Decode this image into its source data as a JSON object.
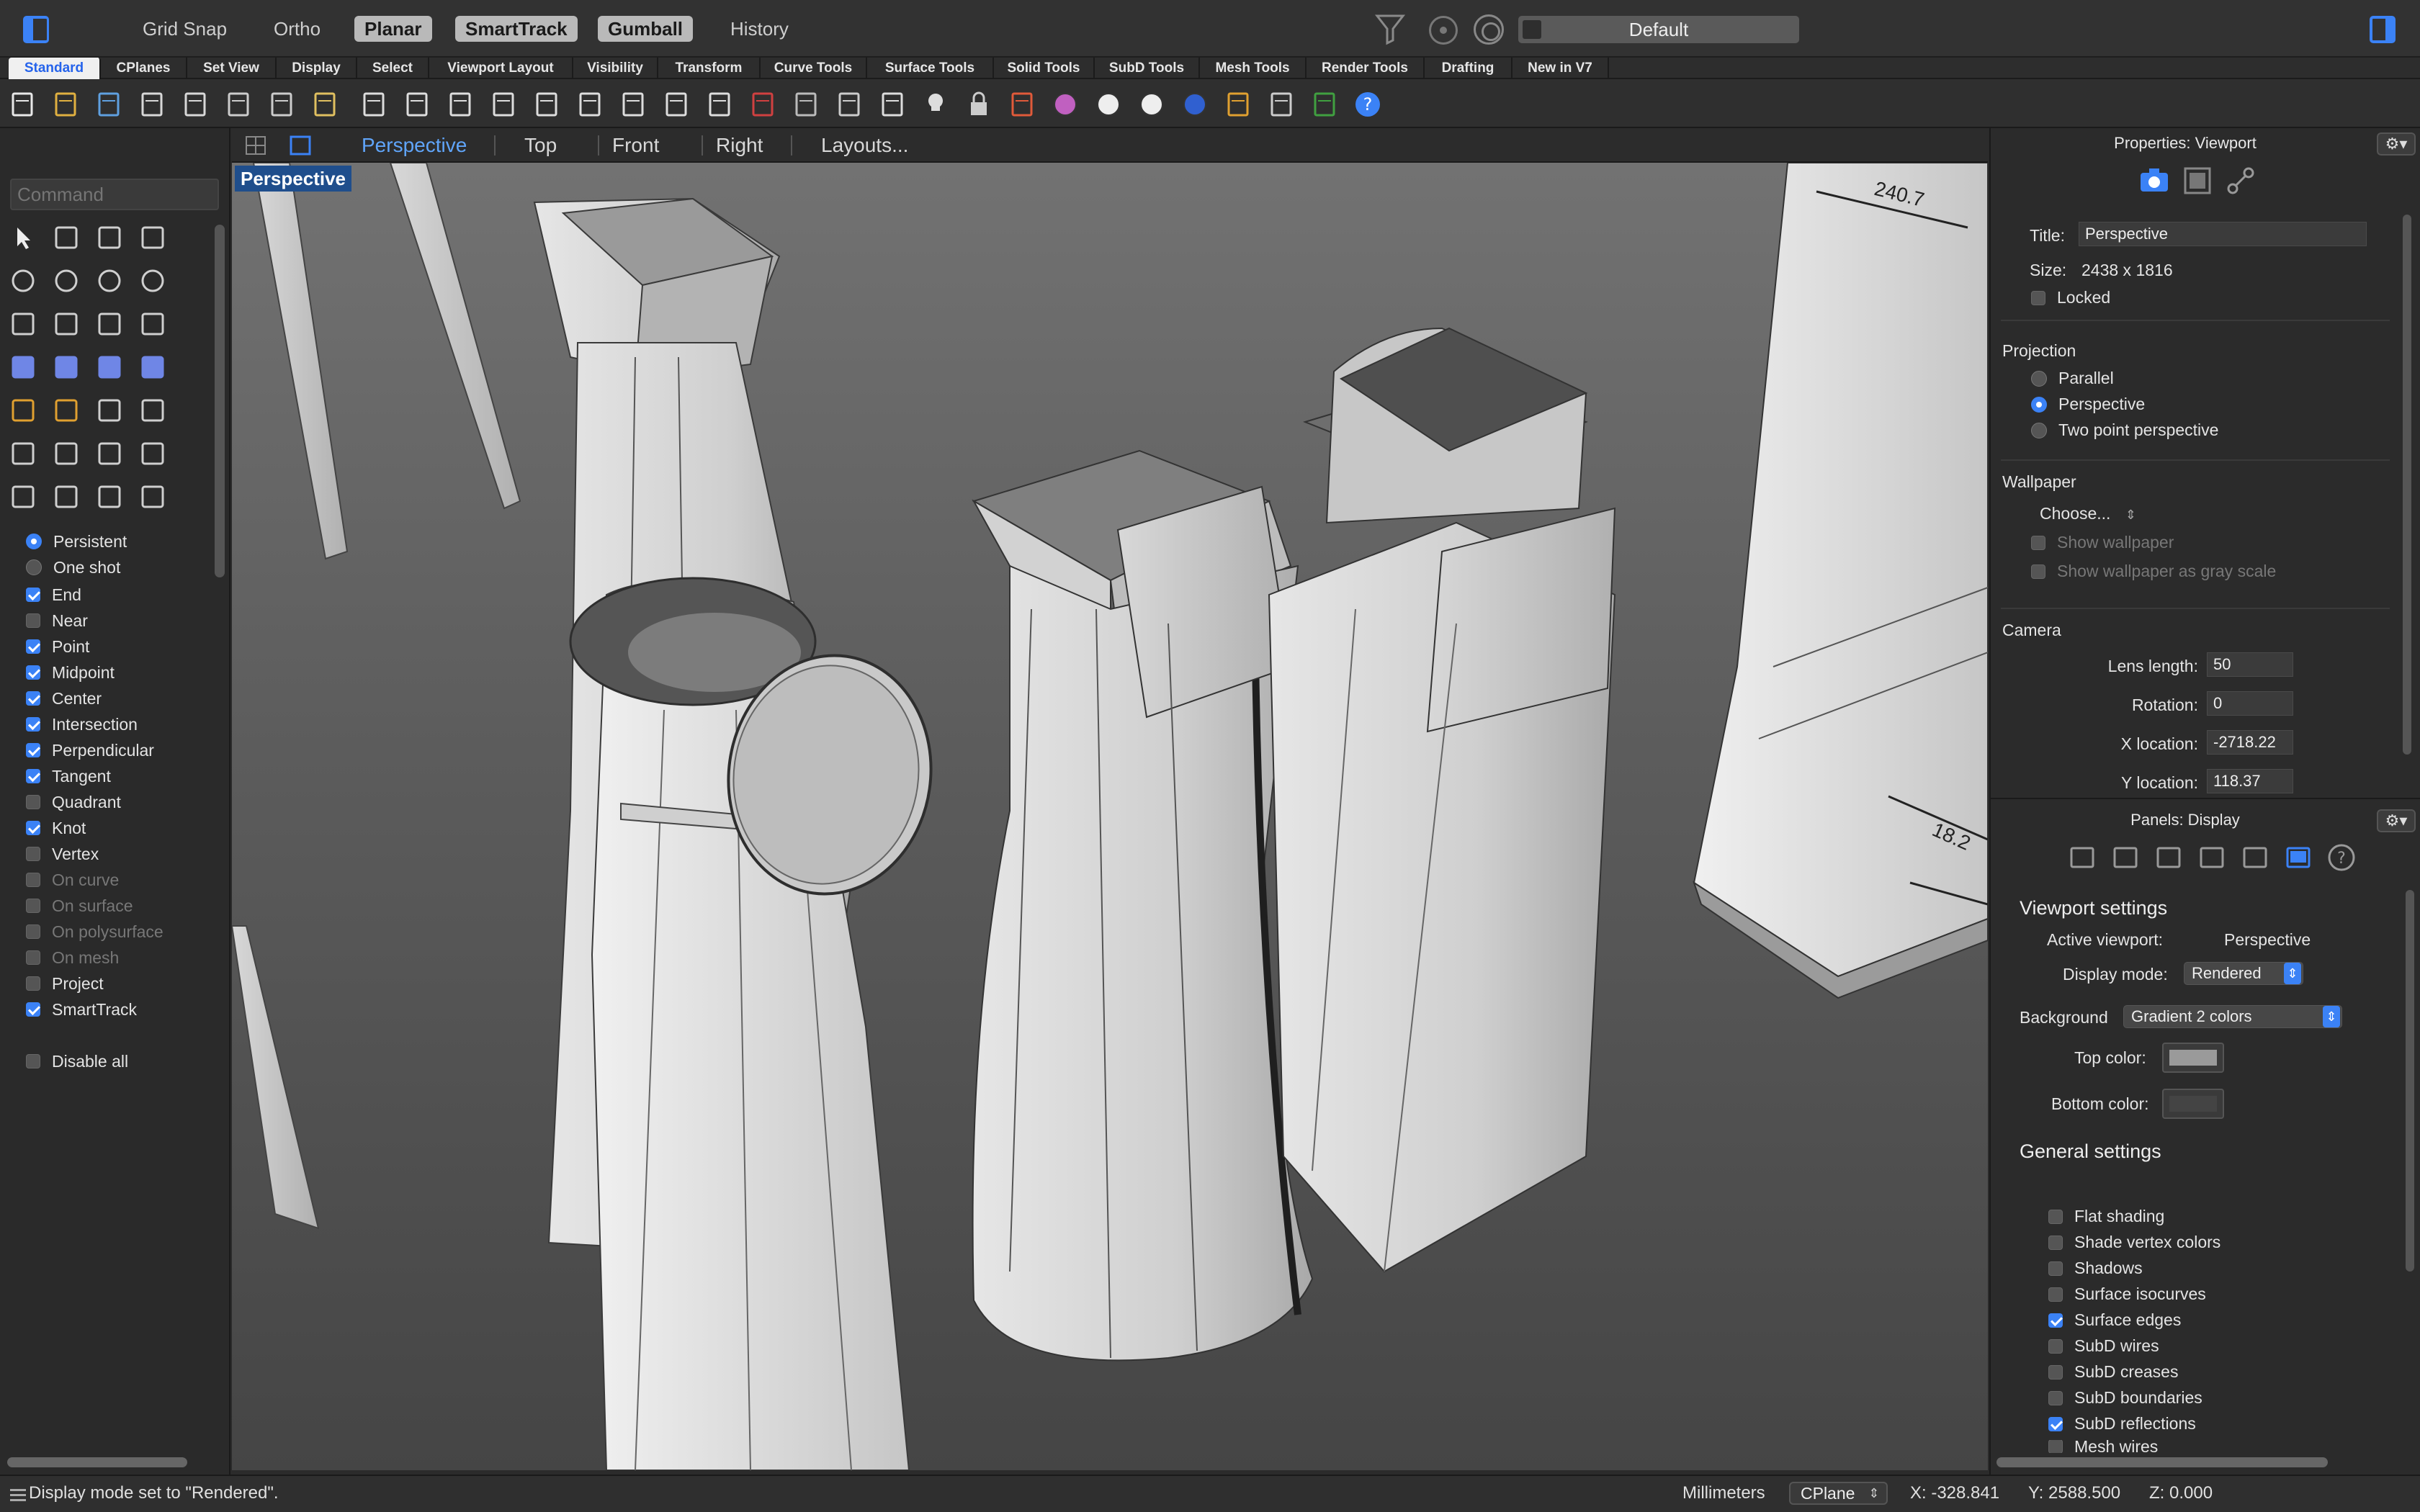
{
  "topbar": {
    "grid_snap": "Grid Snap",
    "ortho": "Ortho",
    "planar": "Planar",
    "smarttrack": "SmartTrack",
    "gumball": "Gumball",
    "history": "History",
    "layer": "Default"
  },
  "tabs": [
    "Standard",
    "CPlanes",
    "Set View",
    "Display",
    "Select",
    "Viewport Layout",
    "Visibility",
    "Transform",
    "Curve Tools",
    "Surface Tools",
    "Solid Tools",
    "SubD Tools",
    "Mesh Tools",
    "Render Tools",
    "Drafting",
    "New in V7"
  ],
  "toolbar_icons": [
    "new-file-icon",
    "open-file-icon",
    "save-icon",
    "print-icon",
    "import-icon",
    "cut-icon",
    "copy-icon",
    "paste-icon",
    "undo-icon",
    "pan-icon",
    "rotate-view-icon",
    "zoom-dynamic-icon",
    "zoom-window-icon",
    "zoom-extents-icon",
    "zoom-selected-icon",
    "undo-view-icon",
    "four-viewports-icon",
    "car-icon",
    "ghosted-car-icon",
    "display-mode-icon",
    "osnap-toggle-icon",
    "lightbulb-icon",
    "lock-icon",
    "layers-icon",
    "color-wheel-icon",
    "shaded-ball-icon",
    "rendered-ball-icon",
    "blue-sphere-icon",
    "render-icon",
    "cplane-grid-icon",
    "globe-icon",
    "help-icon"
  ],
  "left": {
    "command_placeholder": "Command",
    "osnap_mode": [
      {
        "label": "Persistent",
        "checked": true
      },
      {
        "label": "One shot",
        "checked": false
      }
    ],
    "osnaps": [
      {
        "label": "End",
        "checked": true,
        "enabled": true
      },
      {
        "label": "Near",
        "checked": false,
        "enabled": true
      },
      {
        "label": "Point",
        "checked": true,
        "enabled": true
      },
      {
        "label": "Midpoint",
        "checked": true,
        "enabled": true
      },
      {
        "label": "Center",
        "checked": true,
        "enabled": true
      },
      {
        "label": "Intersection",
        "checked": true,
        "enabled": true
      },
      {
        "label": "Perpendicular",
        "checked": true,
        "enabled": true
      },
      {
        "label": "Tangent",
        "checked": true,
        "enabled": true
      },
      {
        "label": "Quadrant",
        "checked": false,
        "enabled": true
      },
      {
        "label": "Knot",
        "checked": true,
        "enabled": true
      },
      {
        "label": "Vertex",
        "checked": false,
        "enabled": true
      },
      {
        "label": "On curve",
        "checked": false,
        "enabled": false
      },
      {
        "label": "On surface",
        "checked": false,
        "enabled": false
      },
      {
        "label": "On polysurface",
        "checked": false,
        "enabled": false
      },
      {
        "label": "On mesh",
        "checked": false,
        "enabled": false
      },
      {
        "label": "Project",
        "checked": false,
        "enabled": true
      },
      {
        "label": "SmartTrack",
        "checked": true,
        "enabled": true
      }
    ],
    "disable_all": "Disable all"
  },
  "viewport": {
    "tabs": [
      "Perspective",
      "Top",
      "Front",
      "Right",
      "Layouts..."
    ],
    "active_tab": "Perspective",
    "label": "Perspective",
    "dims": [
      "240.7",
      "18.2"
    ]
  },
  "properties": {
    "title": "Properties: Viewport",
    "title_label": "Title:",
    "title_value": "Perspective",
    "size_label": "Size:",
    "size_value": "2438 x 1816",
    "locked": "Locked",
    "projection_heading": "Projection",
    "projections": [
      {
        "label": "Parallel",
        "checked": false
      },
      {
        "label": "Perspective",
        "checked": true
      },
      {
        "label": "Two point perspective",
        "checked": false
      }
    ],
    "wallpaper_heading": "Wallpaper",
    "wallpaper_choose": "Choose...",
    "show_wallpaper": "Show wallpaper",
    "show_wallpaper_gray": "Show wallpaper as gray scale",
    "camera_heading": "Camera",
    "camera": [
      {
        "label": "Lens length:",
        "value": "50"
      },
      {
        "label": "Rotation:",
        "value": "0"
      },
      {
        "label": "X location:",
        "value": "-2718.22"
      },
      {
        "label": "Y location:",
        "value": "118.37"
      }
    ]
  },
  "display": {
    "title": "Panels: Display",
    "viewport_settings": "Viewport settings",
    "active_viewport_label": "Active viewport:",
    "active_viewport_value": "Perspective",
    "display_mode_label": "Display mode:",
    "display_mode_value": "Rendered",
    "background_label": "Background",
    "background_value": "Gradient 2 colors",
    "top_color_label": "Top color:",
    "bottom_color_label": "Bottom color:",
    "top_color": "#9a9a9a",
    "bottom_color": "#444444",
    "general_settings": "General settings",
    "options": [
      {
        "label": "Flat shading",
        "checked": false
      },
      {
        "label": "Shade vertex colors",
        "checked": false
      },
      {
        "label": "Shadows",
        "checked": false
      },
      {
        "label": "Surface isocurves",
        "checked": false
      },
      {
        "label": "Surface edges",
        "checked": true
      },
      {
        "label": "SubD wires",
        "checked": false
      },
      {
        "label": "SubD creases",
        "checked": false
      },
      {
        "label": "SubD boundaries",
        "checked": false
      },
      {
        "label": "SubD reflections",
        "checked": true
      },
      {
        "label": "Mesh wires",
        "checked": false
      }
    ]
  },
  "status": {
    "message": "Display mode set to \"Rendered\".",
    "units": "Millimeters",
    "cplane": "CPlane",
    "x": "X: -328.841",
    "y": "Y: 2588.500",
    "z": "Z: 0.000"
  },
  "accent": "#3b82f6"
}
